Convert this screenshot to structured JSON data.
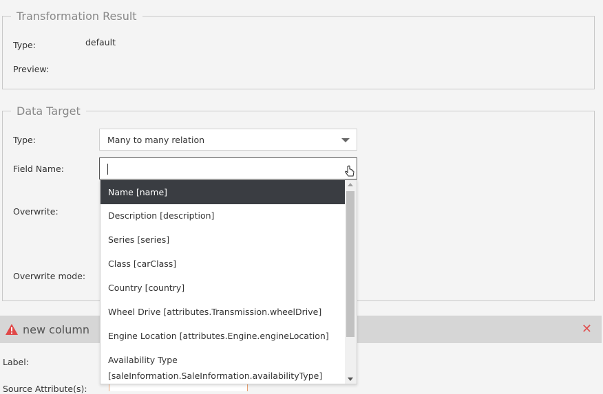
{
  "transformation_result": {
    "legend": "Transformation Result",
    "type_label": "Type:",
    "type_value": "default",
    "preview_label": "Preview:"
  },
  "data_target": {
    "legend": "Data Target",
    "type_label": "Type:",
    "type_value": "Many to many relation",
    "field_name_label": "Field Name:",
    "field_name_value": "",
    "overwrite_label": "Overwrite:",
    "overwrite_mode_label": "Overwrite mode:"
  },
  "dropdown": {
    "options": [
      {
        "label": "Name [name]",
        "selected": true
      },
      {
        "label": "Description [description]"
      },
      {
        "label": "Series [series]"
      },
      {
        "label": "Class [carClass]"
      },
      {
        "label": "Country [country]"
      },
      {
        "label": "Wheel Drive [attributes.Transmission.wheelDrive]"
      },
      {
        "label": "Engine Location [attributes.Engine.engineLocation]"
      },
      {
        "label": "Availability Type"
      },
      {
        "label": "[saleInformation.SaleInformation.availabilityType]"
      }
    ]
  },
  "column": {
    "title": "new column",
    "label_label": "Label:",
    "source_attributes_label": "Source Attribute(s):"
  },
  "colors": {
    "selected_bg": "#3a3d42",
    "close": "#e05050",
    "warning": "#e04848"
  }
}
